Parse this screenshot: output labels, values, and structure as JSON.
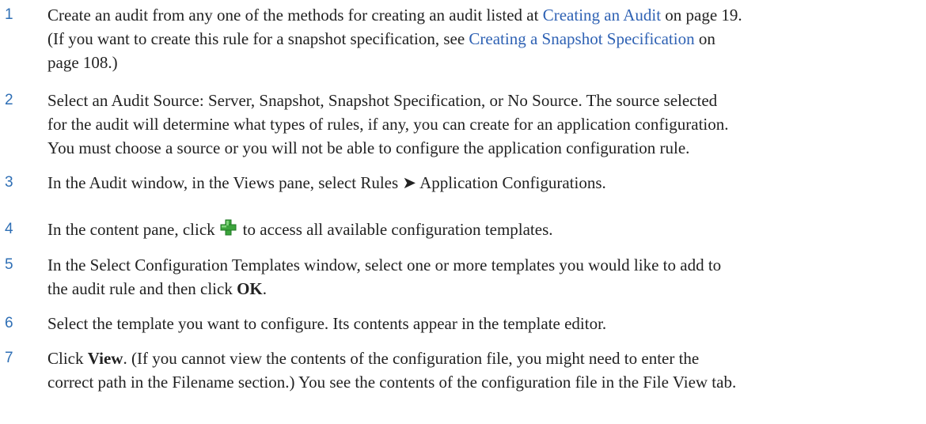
{
  "steps": [
    {
      "number": "1",
      "lines": [
        {
          "t1": "Create an audit from any one of the methods for creating an audit listed at ",
          "link": "Creating an Audit",
          "t2": " on page 19."
        },
        {
          "t1": "(If you want to create this rule for a snapshot specification, see ",
          "link": "Creating a Snapshot Specification",
          "t2": " on"
        },
        {
          "t1": "page 108.)"
        }
      ]
    },
    {
      "number": "2",
      "lines": [
        "Select an Audit Source: Server, Snapshot, Snapshot Specification, or No Source. The source selected",
        "for the audit will determine what types of rules, if any, you can create for an application configuration.",
        "You must choose a source or you will not be able to configure the application configuration rule."
      ]
    },
    {
      "number": "3",
      "before": "In the Audit window, in the Views pane, select Rules ",
      "arrow": "➤",
      "after": " Application Configurations."
    },
    {
      "number": "4",
      "before": "In the content pane, click",
      "icon": "add-plus-icon",
      "after": "to access all available configuration templates."
    },
    {
      "number": "5",
      "line1": "In the Select Configuration Templates window, select one or more templates you would like to add to",
      "line2_before": "the audit rule and then click ",
      "bold": "OK",
      "line2_after": "."
    },
    {
      "number": "6",
      "text": "Select the template you want to configure. Its contents appear in the template editor."
    },
    {
      "number": "7",
      "line1_before": "Click ",
      "bold": "View",
      "line1_after": ". (If you cannot view the contents of the configuration file, you might need to enter the",
      "line2": "correct path in the Filename section.) You see the contents of the configuration file in the File View tab."
    }
  ],
  "colors": {
    "step_number": "#2f6fb5",
    "link": "#2f62b4",
    "body_text": "#222222",
    "icon_green": "#3ca43c"
  }
}
